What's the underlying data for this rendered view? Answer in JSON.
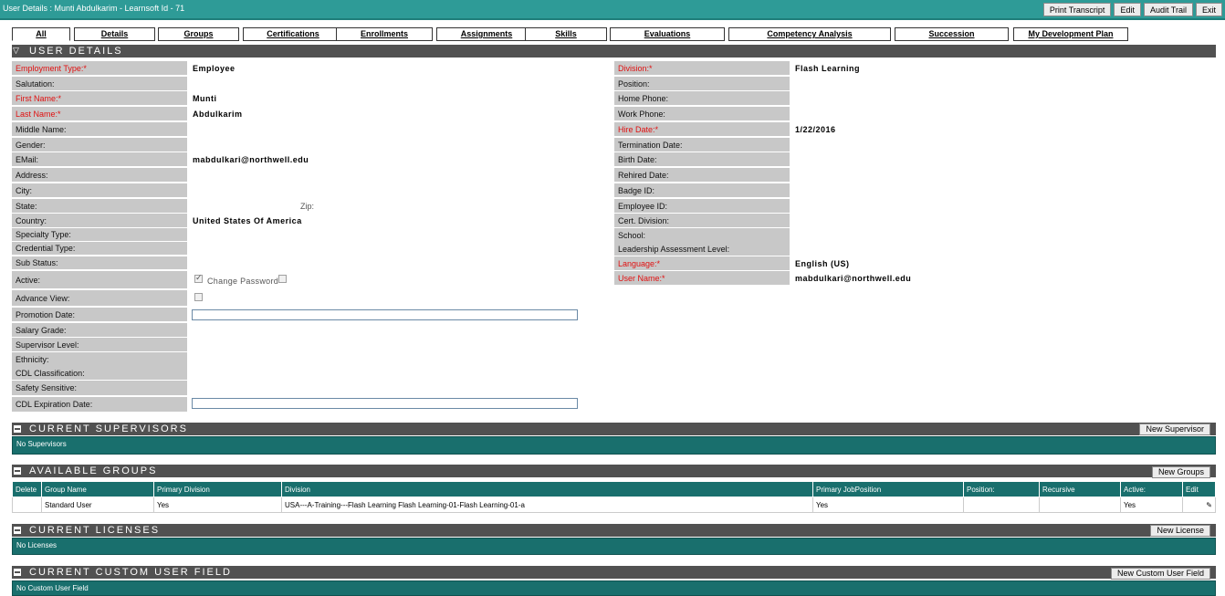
{
  "window": {
    "title": "User Details : Munti Abdulkarim - Learnsoft Id - 71",
    "buttons": [
      "Print Transcript",
      "Edit",
      "Audit Trail",
      "Exit"
    ]
  },
  "tabs": [
    "All",
    "Details",
    "Groups",
    "Certifications",
    "Enrollments",
    "Assignments",
    "Skills",
    "Evaluations",
    "Competency Analysis",
    "Succession",
    "My Development Plan"
  ],
  "user_details": {
    "section_title": "USER DETAILS",
    "left": [
      {
        "label": "Employment Type:*",
        "value": "Employee",
        "required": true
      },
      {
        "label": "Salutation:",
        "value": ""
      },
      {
        "label": "First Name:*",
        "value": "Munti",
        "required": true
      },
      {
        "label": "Last Name:*",
        "value": "Abdulkarim",
        "required": true
      },
      {
        "label": "Middle Name:",
        "value": ""
      },
      {
        "label": "Gender:",
        "value": ""
      },
      {
        "label": "EMail:",
        "value": "mabdulkari@northwell.edu"
      },
      {
        "label": "Address:",
        "value": ""
      },
      {
        "label": "City:",
        "value": ""
      },
      {
        "label": "State:",
        "value": ""
      },
      {
        "label": "Country:",
        "value": "United States Of America"
      },
      {
        "label": "Specialty Type:",
        "value": ""
      },
      {
        "label": "Credential Type:",
        "value": ""
      },
      {
        "label": "Sub Status:",
        "value": ""
      },
      {
        "label": "Active:",
        "value": ""
      },
      {
        "label": "Advance View:",
        "value": ""
      },
      {
        "label": "Promotion Date:",
        "value": ""
      },
      {
        "label": "Salary Grade:",
        "value": ""
      },
      {
        "label": "Supervisor Level:",
        "value": ""
      },
      {
        "label": "Ethnicity:",
        "value": ""
      },
      {
        "label": "CDL Classification:",
        "value": ""
      },
      {
        "label": "Safety Sensitive:",
        "value": ""
      },
      {
        "label": "CDL Expiration Date:",
        "value": ""
      }
    ],
    "zip_label": "Zip:",
    "change_password_label": "Change Password",
    "right": [
      {
        "label": "Division:*",
        "value": "Flash Learning",
        "required": true
      },
      {
        "label": "Position:",
        "value": ""
      },
      {
        "label": "Home Phone:",
        "value": ""
      },
      {
        "label": "Work Phone:",
        "value": ""
      },
      {
        "label": "Hire Date:*",
        "value": "1/22/2016",
        "required": true
      },
      {
        "label": "Termination Date:",
        "value": ""
      },
      {
        "label": "Birth Date:",
        "value": ""
      },
      {
        "label": "Rehired Date:",
        "value": ""
      },
      {
        "label": "Badge ID:",
        "value": ""
      },
      {
        "label": "Employee ID:",
        "value": ""
      },
      {
        "label": "Cert. Division:",
        "value": ""
      },
      {
        "label": "School:",
        "value": ""
      },
      {
        "label": "Leadership Assessment Level:",
        "value": ""
      },
      {
        "label": "Language:*",
        "value": "English (US)",
        "required": true
      },
      {
        "label": "User Name:*",
        "value": "mabdulkari@northwell.edu",
        "required": true
      }
    ]
  },
  "supervisors": {
    "section_title": "CURRENT SUPERVISORS",
    "button": "New Supervisor",
    "empty": "No Supervisors"
  },
  "groups": {
    "section_title": "AVAILABLE GROUPS",
    "button": "New Groups",
    "columns": [
      "Delete",
      "Group Name",
      "Primary Division",
      "Division",
      "Primary JobPosition",
      "Position:",
      "Recursive",
      "Active:",
      "Edit"
    ],
    "rows": [
      {
        "delete": "",
        "group_name": "Standard User",
        "primary_division": "Yes",
        "division": "USA---A-Training---Flash Learning Flash Learning-01-Flash Learning-01-a",
        "primary_jobposition": "Yes",
        "position": "",
        "recursive": "",
        "active": "Yes"
      }
    ]
  },
  "licenses": {
    "section_title": "CURRENT LICENSES",
    "button": "New License",
    "empty": "No Licenses"
  },
  "custom_fields": {
    "section_title": "CURRENT CUSTOM USER FIELD",
    "button": "New Custom User Field",
    "empty": "No Custom User Field"
  }
}
